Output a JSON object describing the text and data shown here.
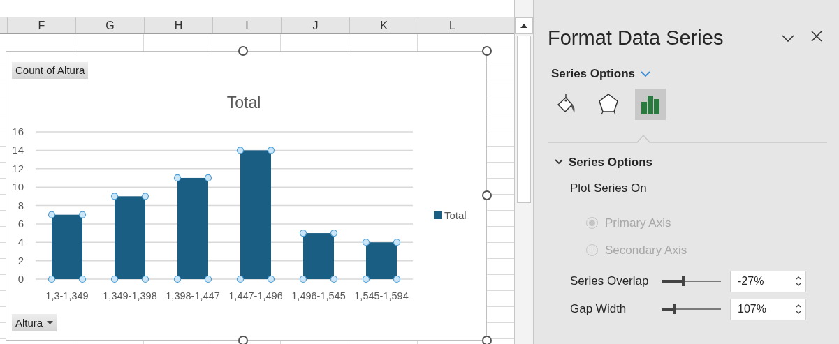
{
  "sheet": {
    "columns": [
      "F",
      "G",
      "H",
      "I",
      "J",
      "K",
      "L"
    ]
  },
  "chart": {
    "value_field_button": "Count of Altura",
    "axis_field_button": "Altura",
    "series_selected": true,
    "chart_data": {
      "type": "bar",
      "title": "Total",
      "categories": [
        "1,3-1,349",
        "1,349-1,398",
        "1,398-1,447",
        "1,447-1,496",
        "1,496-1,545",
        "1,545-1,594"
      ],
      "series": [
        {
          "name": "Total",
          "color": "#1b5e83",
          "values": [
            7,
            9,
            11,
            14,
            5,
            4
          ]
        }
      ],
      "grid": true,
      "ylim": [
        0,
        16
      ],
      "yticks": [
        0,
        2,
        4,
        6,
        8,
        10,
        12,
        14,
        16
      ]
    }
  },
  "panel": {
    "title": "Format Data Series",
    "options_menu": "Series Options",
    "tabs": [
      {
        "kind": "fill",
        "selected": false
      },
      {
        "kind": "effects",
        "selected": false
      },
      {
        "kind": "series",
        "selected": true
      }
    ],
    "section": {
      "title": "Series Options",
      "expanded": true,
      "plot_label": "Plot Series On",
      "radios": [
        {
          "label": "Primary Axis",
          "selected": true,
          "disabled": true
        },
        {
          "label": "Secondary Axis",
          "selected": false,
          "disabled": true
        }
      ],
      "sliders": [
        {
          "label": "Series Overlap",
          "level": 0.37,
          "value": "-27%"
        },
        {
          "label": "Gap Width",
          "level": 0.21,
          "value": "107%"
        }
      ]
    }
  }
}
